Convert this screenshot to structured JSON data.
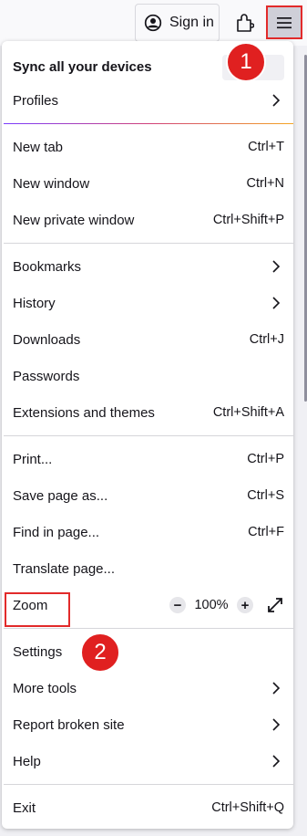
{
  "toolbar": {
    "signin_label": "Sign in"
  },
  "menu": {
    "sync_label": "Sync all your devices",
    "profiles": "Profiles",
    "new_tab": {
      "label": "New tab",
      "shortcut": "Ctrl+T"
    },
    "new_window": {
      "label": "New window",
      "shortcut": "Ctrl+N"
    },
    "new_private_window": {
      "label": "New private window",
      "shortcut": "Ctrl+Shift+P"
    },
    "bookmarks": "Bookmarks",
    "history": "History",
    "downloads": {
      "label": "Downloads",
      "shortcut": "Ctrl+J"
    },
    "passwords": "Passwords",
    "extensions": {
      "label": "Extensions and themes",
      "shortcut": "Ctrl+Shift+A"
    },
    "print": {
      "label": "Print...",
      "shortcut": "Ctrl+P"
    },
    "save_page": {
      "label": "Save page as...",
      "shortcut": "Ctrl+S"
    },
    "find_in_page": {
      "label": "Find in page...",
      "shortcut": "Ctrl+F"
    },
    "translate_page": "Translate page...",
    "zoom": {
      "label": "Zoom",
      "minus": "−",
      "value": "100%",
      "plus": "+"
    },
    "settings": "Settings",
    "more_tools": "More tools",
    "report_broken_site": "Report broken site",
    "help": "Help",
    "exit": {
      "label": "Exit",
      "shortcut": "Ctrl+Shift+Q"
    }
  },
  "annotations": {
    "badge_1": "1",
    "badge_2": "2",
    "highlight_color": "#e22a2a"
  },
  "icons": [
    "account-icon",
    "extensions-icon",
    "hamburger-menu-icon",
    "chevron-right-icon",
    "fullscreen-icon"
  ]
}
